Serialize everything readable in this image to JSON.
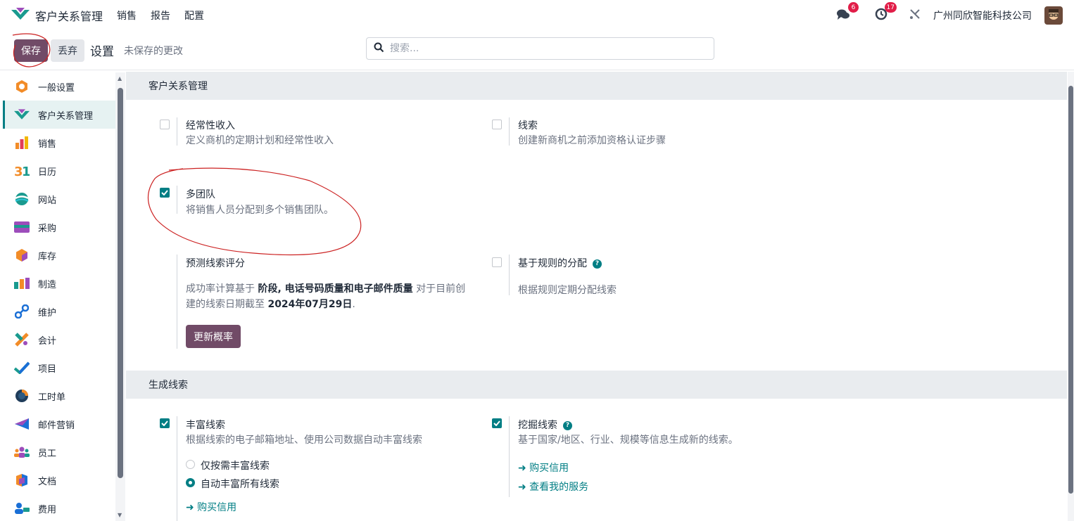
{
  "topnav": {
    "app_name": "客户关系管理",
    "menu": [
      "销售",
      "报告",
      "配置"
    ],
    "messages_count": "6",
    "activities_count": "17",
    "company": "广州同欣智能科技公司"
  },
  "control": {
    "save_label": "保存",
    "discard_label": "丢弃",
    "title": "设置",
    "unsaved_text": "未保存的更改",
    "search_placeholder": "搜索..."
  },
  "sidebar": {
    "items": [
      {
        "label": "一般设置",
        "icon": "general-settings-icon"
      },
      {
        "label": "客户关系管理",
        "icon": "crm-icon",
        "active": true
      },
      {
        "label": "销售",
        "icon": "sales-icon"
      },
      {
        "label": "日历",
        "icon": "calendar-icon"
      },
      {
        "label": "网站",
        "icon": "website-icon"
      },
      {
        "label": "采购",
        "icon": "purchase-icon"
      },
      {
        "label": "库存",
        "icon": "inventory-icon"
      },
      {
        "label": "制造",
        "icon": "manufacturing-icon"
      },
      {
        "label": "维护",
        "icon": "maintenance-icon"
      },
      {
        "label": "会计",
        "icon": "accounting-icon"
      },
      {
        "label": "项目",
        "icon": "project-icon"
      },
      {
        "label": "工时单",
        "icon": "timesheet-icon"
      },
      {
        "label": "邮件营销",
        "icon": "email-marketing-icon"
      },
      {
        "label": "员工",
        "icon": "employees-icon"
      },
      {
        "label": "文档",
        "icon": "documents-icon"
      },
      {
        "label": "费用",
        "icon": "expenses-icon"
      }
    ]
  },
  "crm_section": {
    "header": "客户关系管理",
    "recurring": {
      "title": "经常性收入",
      "desc": "定义商机的定期计划和经常性收入",
      "checked": false
    },
    "leads": {
      "title": "线索",
      "desc": "创建新商机之前添加资格认证步骤",
      "checked": false
    },
    "multi_team": {
      "title": "多团队",
      "desc": "将销售人员分配到多个销售团队。",
      "checked": true
    },
    "predictive": {
      "title": "预测线索评分",
      "desc_prefix": "成功率计算基于 ",
      "desc_bold1": "阶段, 电话号码质量和电子邮件质量",
      "desc_mid": " 对于目前创",
      "desc_line2_prefix": "建的线索日期截至 ",
      "desc_bold2": "2024年07月29日",
      "desc_end": ".",
      "button": "更新概率"
    },
    "rule_assign": {
      "title": "基于规则的分配",
      "desc": "根据规则定期分配线索",
      "checked": false
    }
  },
  "lead_gen_section": {
    "header": "生成线索",
    "enrich": {
      "title": "丰富线索",
      "desc": "根据线索的电子邮箱地址、使用公司数据自动丰富线索",
      "checked": true,
      "option_on_demand": "仅按需丰富线索",
      "option_auto": "自动丰富所有线索",
      "selected": "auto",
      "link_buy": "➜ 购买信用"
    },
    "mine": {
      "title": "挖掘线索",
      "desc": "基于国家/地区、行业、规模等信息生成新的线索。",
      "checked": true,
      "link_buy": "➜ 购买信用",
      "link_services": "➜ 查看我的服务"
    }
  },
  "colors": {
    "primary": "#714B67",
    "teal": "#017e84",
    "annotation": "#cc2222"
  }
}
